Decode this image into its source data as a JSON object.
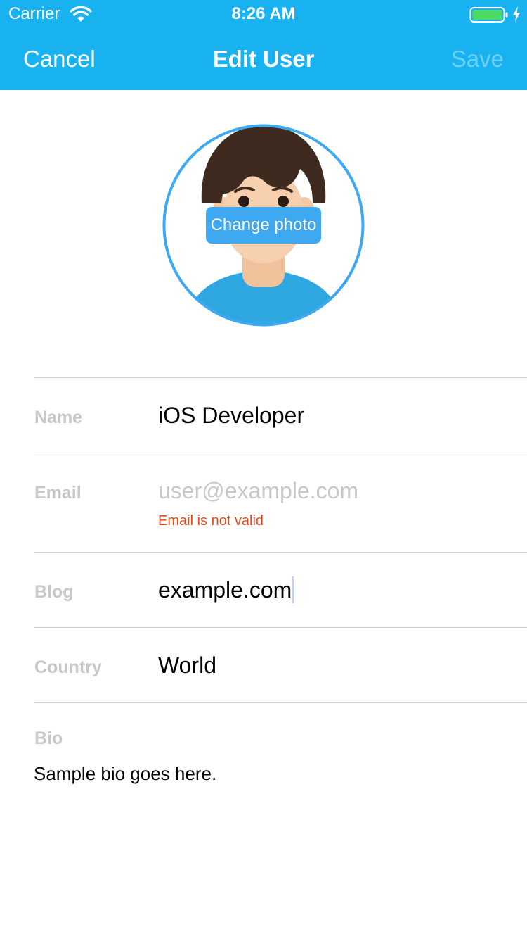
{
  "status_bar": {
    "carrier": "Carrier",
    "time": "8:26 AM",
    "wifi_icon": "wifi-icon",
    "battery_icon": "battery-icon",
    "charging_icon": "charging-bolt-icon",
    "battery_level": 1.0
  },
  "nav": {
    "cancel_label": "Cancel",
    "title": "Edit User",
    "save_label": "Save",
    "save_enabled": false
  },
  "avatar": {
    "change_photo_label": "Change photo"
  },
  "form": {
    "name": {
      "label": "Name",
      "value": "iOS Developer"
    },
    "email": {
      "label": "Email",
      "value": "",
      "placeholder": "user@example.com",
      "error": "Email is not valid"
    },
    "blog": {
      "label": "Blog",
      "value": "example.com"
    },
    "country": {
      "label": "Country",
      "value": "World"
    },
    "bio": {
      "label": "Bio",
      "value": "Sample bio goes here."
    }
  },
  "colors": {
    "nav_background": "#17b2ef",
    "accent": "#3ea8f0",
    "error": "#e64a19",
    "label": "#c7c7cc",
    "save_disabled": "#6ed1f6"
  }
}
